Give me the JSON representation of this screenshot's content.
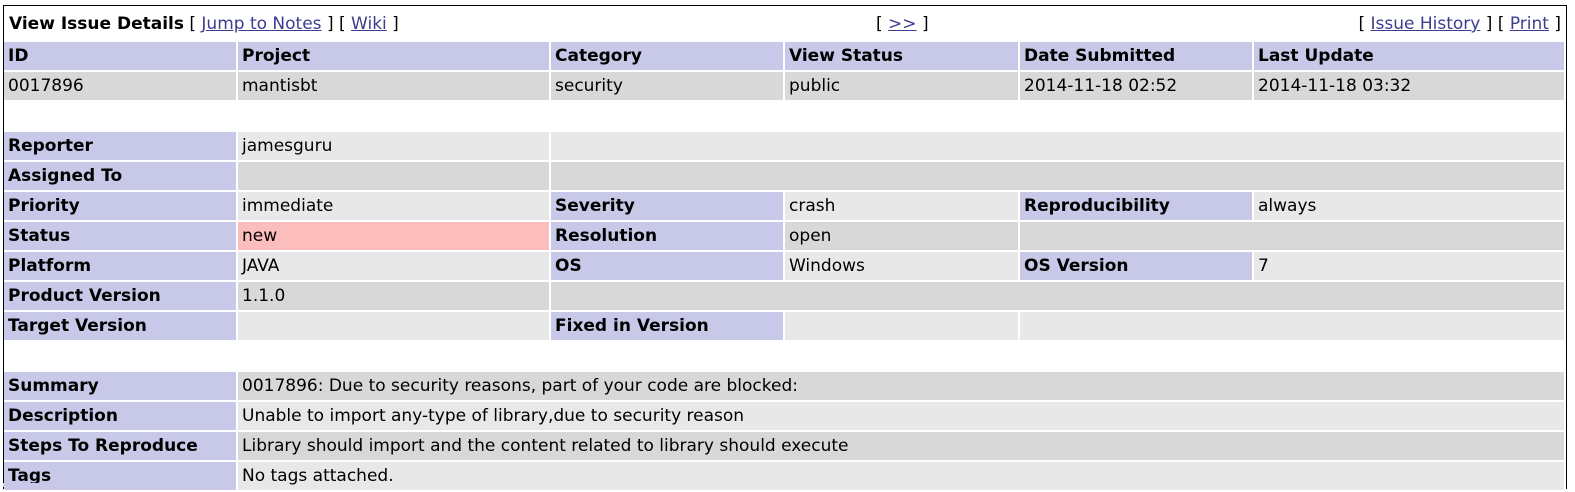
{
  "header": {
    "title": "View Issue Details",
    "jump_to_notes": "Jump to Notes",
    "wiki": "Wiki",
    "next": ">>",
    "issue_history": "Issue History",
    "print": "Print"
  },
  "top": {
    "labels": {
      "id": "ID",
      "project": "Project",
      "category": "Category",
      "view_status": "View Status",
      "date_submitted": "Date Submitted",
      "last_update": "Last Update"
    },
    "values": {
      "id": "0017896",
      "project": "mantisbt",
      "category": "security",
      "view_status": "public",
      "date_submitted": "2014-11-18 02:52",
      "last_update": "2014-11-18 03:32"
    }
  },
  "details": {
    "reporter": {
      "label": "Reporter",
      "value": "jamesguru"
    },
    "assigned_to": {
      "label": "Assigned To",
      "value": ""
    },
    "priority": {
      "label": "Priority",
      "value": "immediate"
    },
    "severity": {
      "label": "Severity",
      "value": "crash"
    },
    "reproducibility": {
      "label": "Reproducibility",
      "value": "always"
    },
    "status": {
      "label": "Status",
      "value": "new"
    },
    "resolution": {
      "label": "Resolution",
      "value": "open"
    },
    "platform": {
      "label": "Platform",
      "value": "JAVA"
    },
    "os": {
      "label": "OS",
      "value": "Windows"
    },
    "os_version": {
      "label": "OS Version",
      "value": "7"
    },
    "product_version": {
      "label": "Product Version",
      "value": "1.1.0"
    },
    "target_version": {
      "label": "Target Version",
      "value": ""
    },
    "fixed_in_version": {
      "label": "Fixed in Version",
      "value": ""
    }
  },
  "text": {
    "summary": {
      "label": "Summary",
      "value": "0017896: Due to security reasons, part of your code are blocked:"
    },
    "description": {
      "label": "Description",
      "value": "Unable to import any-type of library,due to security reason"
    },
    "steps": {
      "label": "Steps To Reproduce",
      "value": "Library should import and the content related to library should execute"
    },
    "tags": {
      "label": "Tags",
      "value": "No tags attached."
    }
  },
  "colors": {
    "label_bg": "#c8c8e8",
    "row_light": "#e8e8e8",
    "row_dark": "#d8d8d8",
    "status_new": "#fcbdbd",
    "link": "#3d3d8f"
  }
}
